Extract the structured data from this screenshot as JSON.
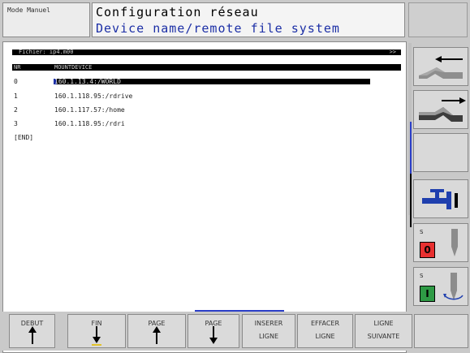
{
  "header": {
    "mode": "Mode Manuel",
    "title": "Configuration réseau",
    "subtitle": "Device name/remote file system"
  },
  "file": {
    "label": "Fichier: ip4.m00",
    "nav": ">>"
  },
  "table": {
    "col_nr": "NR",
    "col_mount": "MOUNTDEVICE",
    "rows": [
      {
        "nr": "0",
        "mount": "160.1.13.4:/WORLD"
      },
      {
        "nr": "1",
        "mount": "160.1.118.95:/rdrive"
      },
      {
        "nr": "2",
        "mount": "160.1.117.57:/home"
      },
      {
        "nr": "3",
        "mount": "160.1.118.95:/rdri"
      }
    ],
    "end": "[END]"
  },
  "side": {
    "spindle_stop_label": "S",
    "spindle_stop_value": "0",
    "spindle_start_label": "S",
    "spindle_start_value": "I",
    "colors": {
      "stop": "#e83030",
      "start": "#2e9a45"
    }
  },
  "softkeys": {
    "debut": "DEBUT",
    "fin": "FIN",
    "page_up": "PAGE",
    "page_down": "PAGE",
    "insert_l1": "INSERER",
    "insert_l2": "LIGNE",
    "delete_l1": "EFFACER",
    "delete_l2": "LIGNE",
    "next_l1": "LIGNE",
    "next_l2": "SUIVANTE"
  },
  "icons": [
    "arrow-left-icon",
    "arrow-right-icon",
    "coolant-valve-icon",
    "spindle-icon"
  ]
}
